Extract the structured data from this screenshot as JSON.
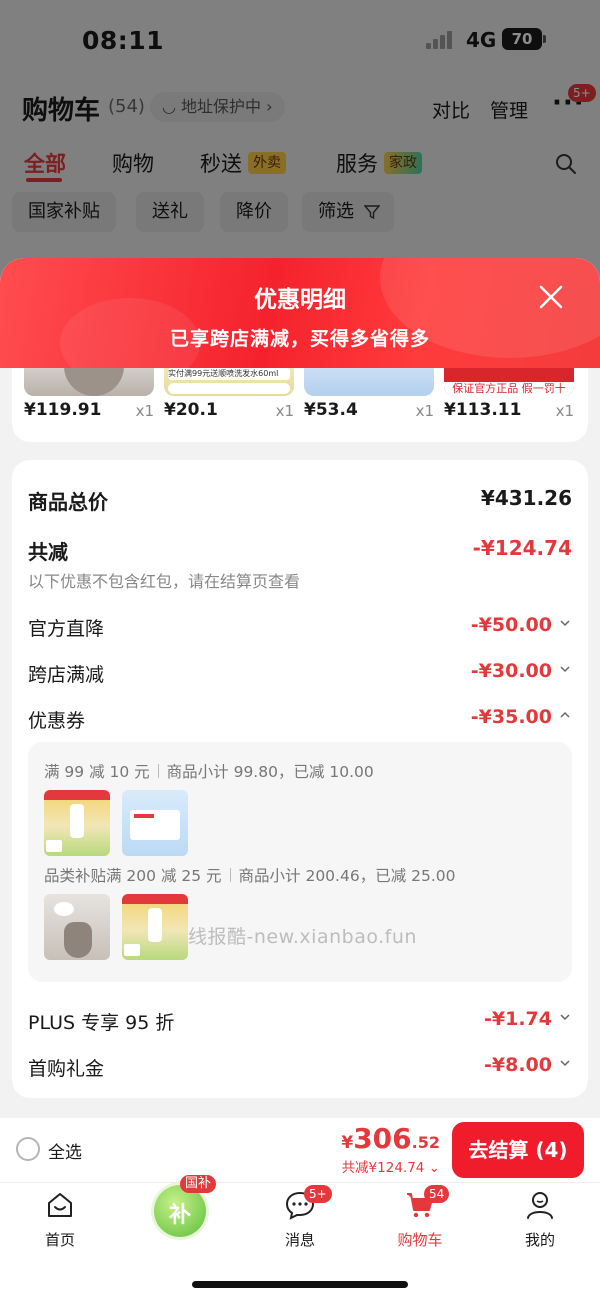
{
  "status_bar": {
    "time": "08:11",
    "network": "4G",
    "battery": "70"
  },
  "cart_header": {
    "title": "购物车",
    "count": "(54)",
    "address": "地址保护中 ›",
    "compare": "对比",
    "manage": "管理",
    "more_badge": "5+"
  },
  "tabs": [
    {
      "label": "全部"
    },
    {
      "label": "购物"
    },
    {
      "label": "秒送",
      "tag": "外卖"
    },
    {
      "label": "服务",
      "tag": "家政"
    }
  ],
  "chips": [
    "国家补贴",
    "送礼",
    "降价",
    "筛选"
  ],
  "sheet": {
    "title": "优惠明细",
    "subtitle": "已享跨店满减，买得多省得多"
  },
  "products": [
    {
      "price": "¥119.91",
      "qty": "x1"
    },
    {
      "price": "¥20.1",
      "qty": "x1",
      "img_text": "实付满99元送顺喷洗发水60ml"
    },
    {
      "price": "¥53.4",
      "qty": "x1"
    },
    {
      "price": "¥113.11",
      "qty": "x1",
      "img_text": "保证官方正品 假一罚十"
    }
  ],
  "summary": {
    "goods_total_label": "商品总价",
    "goods_total": "¥431.26",
    "total_discount_label": "共减",
    "total_discount": "-¥124.74",
    "note": "以下优惠不包含红包，请在结算页查看",
    "items": [
      {
        "label": "官方直降",
        "value": "-¥50.00"
      },
      {
        "label": "跨店满减",
        "value": "-¥30.00"
      },
      {
        "label": "优惠券",
        "value": "-¥35.00"
      }
    ],
    "coupons": [
      {
        "rule": "满 99 减 10 元",
        "detail": "商品小计 99.80，已减 10.00"
      },
      {
        "rule": "品类补贴满 200 减 25 元",
        "detail": "商品小计 200.46，已减 25.00"
      }
    ],
    "more_items": [
      {
        "label": "PLUS 专享 95 折",
        "value": "-¥1.74"
      },
      {
        "label": "首购礼金",
        "value": "-¥8.00"
      }
    ]
  },
  "watermark": "线报酷-new.xianbao.fun",
  "checkout": {
    "select_all": "全选",
    "price_symbol": "¥",
    "price_int": "306",
    "price_dec": ".52",
    "saved": "共减¥124.74",
    "button": "去结算 (4)"
  },
  "tabbar": {
    "items": [
      {
        "label": "首页"
      },
      {
        "label": "国补"
      },
      {
        "label": "消息",
        "badge": "5+"
      },
      {
        "label": "购物车",
        "badge": "54"
      },
      {
        "label": "我的"
      }
    ],
    "subsidy_glyph": "补"
  },
  "colors": {
    "accent": "#e4393c",
    "button": "#f01c2c"
  }
}
